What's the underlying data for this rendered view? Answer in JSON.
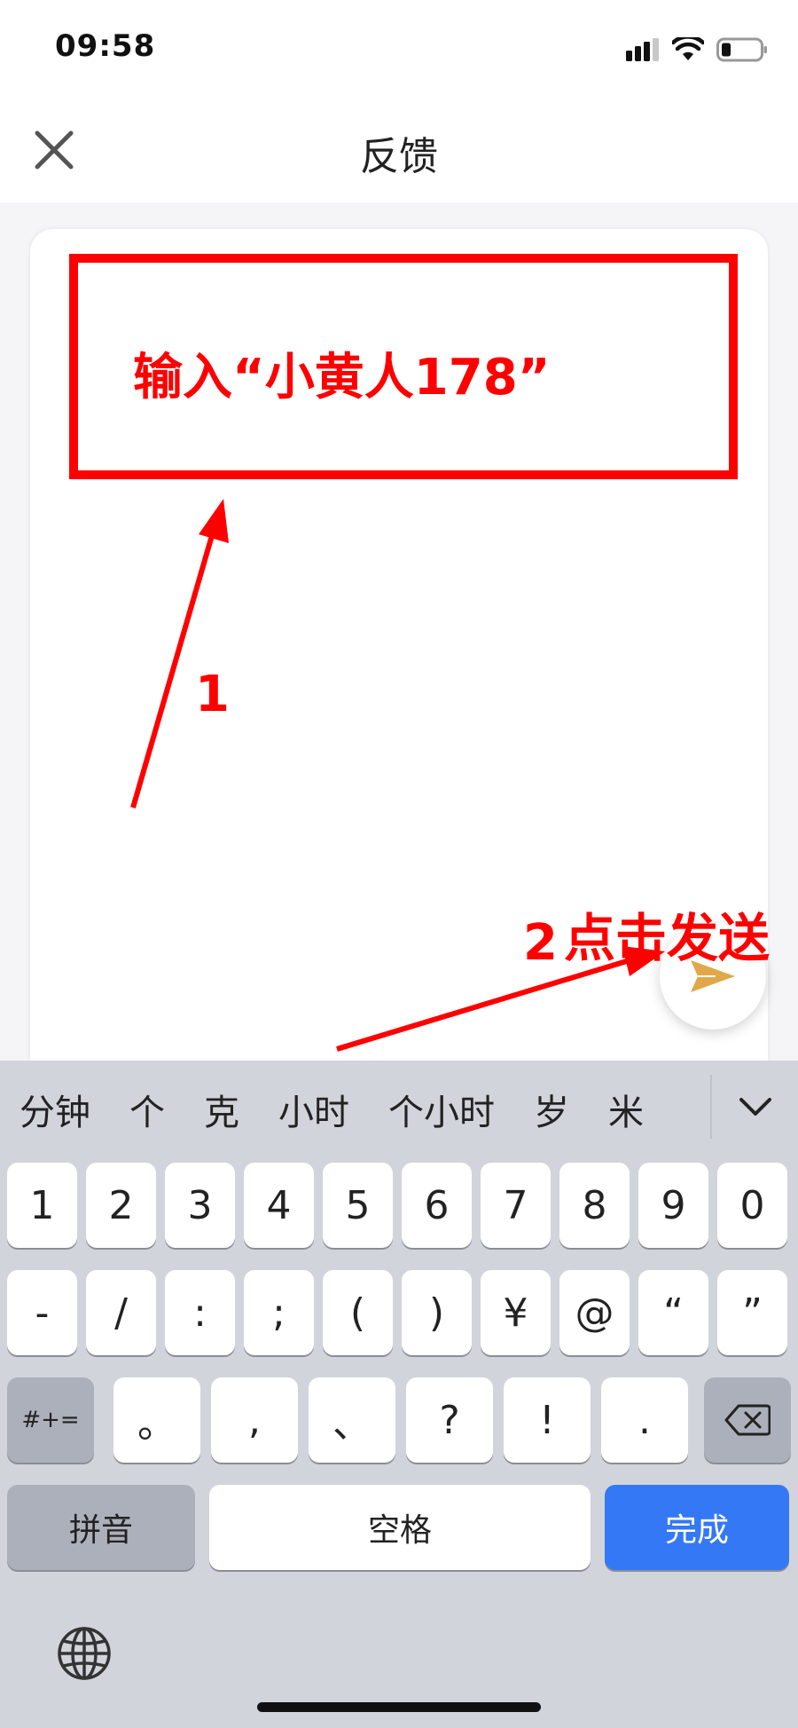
{
  "status": {
    "time": "09:58"
  },
  "nav": {
    "title": "反馈"
  },
  "feedback": {
    "placeholder": ""
  },
  "annotations": {
    "step1_instruction": "输入“小黄人178”",
    "step1_number": "1",
    "step2_number": "2",
    "step2_instruction": "点击发送",
    "color": "#ff0000"
  },
  "keyboard": {
    "candidates": [
      "分钟",
      "个",
      "克",
      "小时",
      "个小时",
      "岁",
      "米"
    ],
    "row1": [
      "1",
      "2",
      "3",
      "4",
      "5",
      "6",
      "7",
      "8",
      "9",
      "0"
    ],
    "row2": [
      "-",
      "/",
      ":",
      ";",
      "(",
      ")",
      "¥",
      "@",
      "“",
      "”"
    ],
    "row3_left": "#+=",
    "row3": [
      "。",
      ",",
      "、",
      "?",
      "!",
      "."
    ],
    "pinyin": "拼音",
    "space": "空格",
    "done": "完成",
    "done_color": "#3478f6"
  },
  "icons": [
    "signal-icon",
    "wifi-icon",
    "battery-icon",
    "close-icon",
    "send-icon",
    "chevron-down-icon",
    "backspace-icon",
    "globe-icon"
  ]
}
